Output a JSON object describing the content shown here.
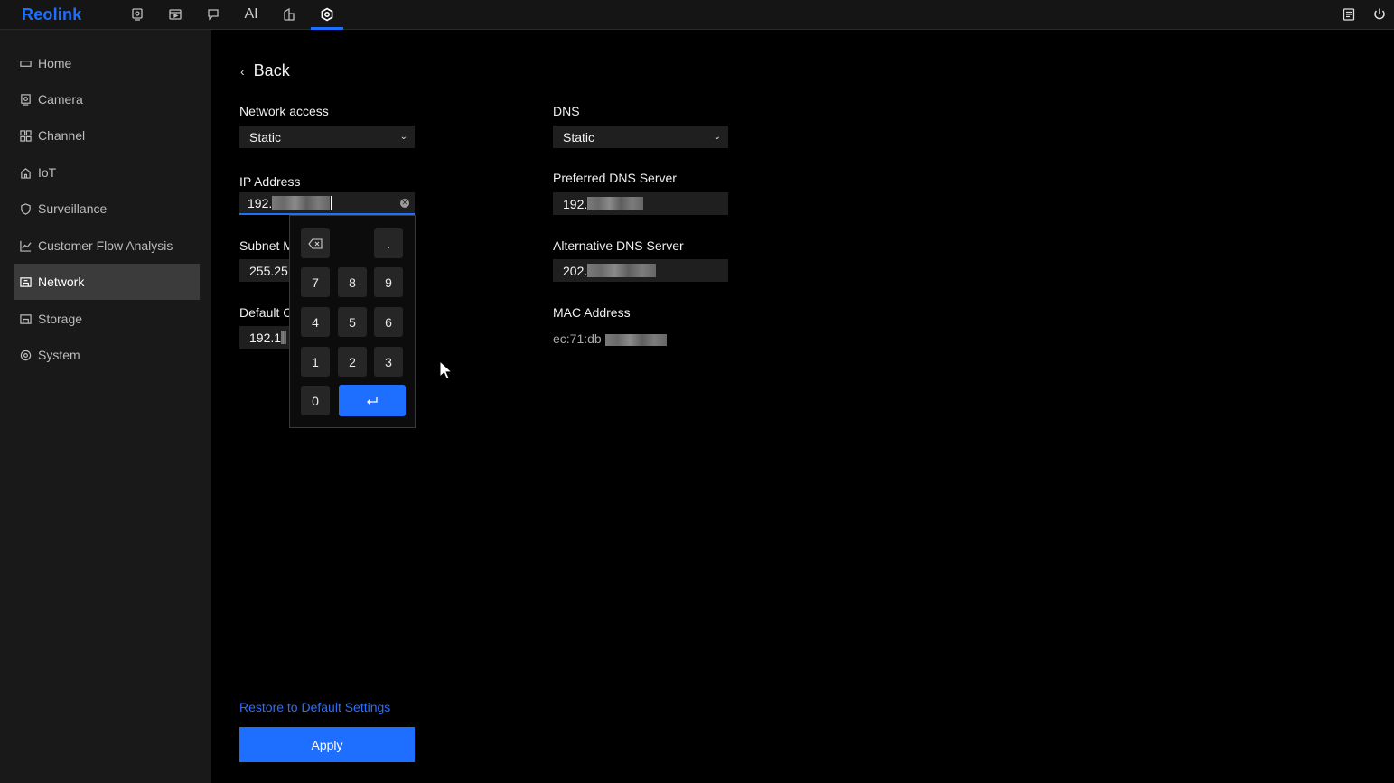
{
  "app": {
    "logo": "Reolink",
    "accent_color": "#1e6fff"
  },
  "topbar": {
    "icons": [
      "camera-live-icon",
      "playback-icon",
      "message-icon",
      "ai-icon",
      "device-icon",
      "settings-icon",
      "notes-icon",
      "power-icon"
    ],
    "ai_label": "AI",
    "active_tab": "settings-icon"
  },
  "sidebar": {
    "items": [
      {
        "label": "Home",
        "icon": "home-rect-icon"
      },
      {
        "label": "Camera",
        "icon": "camera-icon"
      },
      {
        "label": "Channel",
        "icon": "grid-icon"
      },
      {
        "label": "IoT",
        "icon": "house-icon"
      },
      {
        "label": "Surveillance",
        "icon": "shield-icon"
      },
      {
        "label": "Customer Flow Analysis",
        "icon": "chart-icon"
      },
      {
        "label": "Network",
        "icon": "network-icon",
        "active": true
      },
      {
        "label": "Storage",
        "icon": "storage-icon"
      },
      {
        "label": "System",
        "icon": "gear-icon"
      }
    ]
  },
  "page": {
    "back_label": "Back",
    "network_access": {
      "label": "Network access",
      "value": "Static"
    },
    "ip_address": {
      "label": "IP Address",
      "value_prefix": "192."
    },
    "subnet_mask": {
      "label": "Subnet M",
      "value_prefix": "255.25"
    },
    "default_gateway": {
      "label": "Default C",
      "value_prefix": "192.1"
    },
    "dns": {
      "label": "DNS",
      "value": "Static"
    },
    "preferred_dns": {
      "label": "Preferred DNS Server",
      "value_prefix": "192."
    },
    "alternative_dns": {
      "label": "Alternative DNS Server",
      "value_prefix": "202."
    },
    "mac_address": {
      "label": "MAC Address",
      "value_prefix": "ec:71:db"
    },
    "restore_label": "Restore to Default Settings",
    "apply_label": "Apply"
  },
  "keypad": {
    "dot": ".",
    "rows": [
      [
        "7",
        "8",
        "9"
      ],
      [
        "4",
        "5",
        "6"
      ],
      [
        "1",
        "2",
        "3"
      ]
    ],
    "zero": "0",
    "backspace_icon": "backspace-icon",
    "enter_icon": "enter-icon"
  }
}
